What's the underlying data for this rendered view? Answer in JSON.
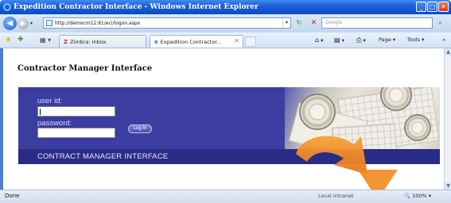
{
  "window": {
    "title": "Expedition Contractor Interface - Windows Internet Explorer",
    "minimize_glyph": "_",
    "maximize_glyph": "□",
    "close_glyph": "✕"
  },
  "nav": {
    "back_glyph": "◀",
    "forward_glyph": "▶",
    "dropdown_glyph": "▾",
    "refresh_glyph": "↻",
    "stop_glyph": "✕",
    "address_url": "http://democm12:81/eci/logon.aspx",
    "search_placeholder": "Google",
    "search_go_glyph": "⌕"
  },
  "tabs": {
    "items": [
      {
        "label": "Zimbra: Inbox",
        "icon": "Z"
      },
      {
        "label": "Expedition Contractor...",
        "icon": "e",
        "close": "✕"
      }
    ],
    "commands": {
      "home_glyph": "⌂",
      "feeds_glyph": "▤",
      "print_glyph": "⎙",
      "page_label": "Page",
      "tools_label": "Tools",
      "more_glyph": "»"
    }
  },
  "page": {
    "heading": "Contractor Manager Interface",
    "user_label": "user id:",
    "password_label": "password:",
    "login_button": "Log In",
    "footer_banner": "CONTRACT MANAGER INTERFACE"
  },
  "status": {
    "text": "Done",
    "zone": "Local intranet",
    "zoom": "100%"
  },
  "colors": {
    "panel": "#3b3da0",
    "panel_footer": "#2a2b86",
    "arrow": "#f28a1e"
  }
}
